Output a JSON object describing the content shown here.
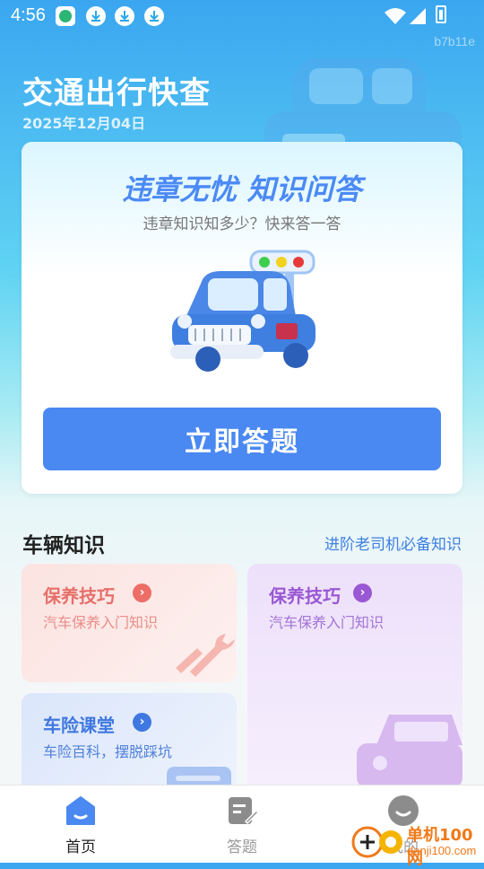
{
  "status_bar": {
    "time": "4:56",
    "icons": [
      "app-notification-icon",
      "download-icon",
      "download-icon",
      "download-icon",
      "wifi-icon",
      "signal-icon",
      "battery-icon"
    ]
  },
  "header": {
    "watermark_code": "b7b11e",
    "title": "交通出行快查",
    "date": "2025年12月04日"
  },
  "quiz_card": {
    "title": "违章无忧 知识问答",
    "subtitle": "违章知识知多少？快来答一答",
    "button_label": "立即答题"
  },
  "section": {
    "title": "车辆知识",
    "link": "进阶老司机必备知识"
  },
  "tiles": [
    {
      "title": "保养技巧",
      "desc": "汽车保养入门知识",
      "icon": "wrench-icon"
    },
    {
      "title": "保养技巧",
      "desc": "汽车保养入门知识",
      "icon": "car-icon"
    },
    {
      "title": "车险课堂",
      "desc": "车险百科，摆脱踩坑",
      "icon": "card-icon"
    }
  ],
  "tab_bar": {
    "items": [
      {
        "label": "首页",
        "icon": "home-icon",
        "active": true
      },
      {
        "label": "答题",
        "icon": "edit-icon",
        "active": false
      },
      {
        "label": "我的",
        "icon": "profile-icon",
        "active": false
      }
    ]
  },
  "site_watermark": {
    "name": "单机100网",
    "url": "danji100.com"
  },
  "colors": {
    "primary": "#4a88f2",
    "tile_red": "#ec6e66",
    "tile_purple": "#9a58d4",
    "tile_blue": "#3f78e0"
  }
}
